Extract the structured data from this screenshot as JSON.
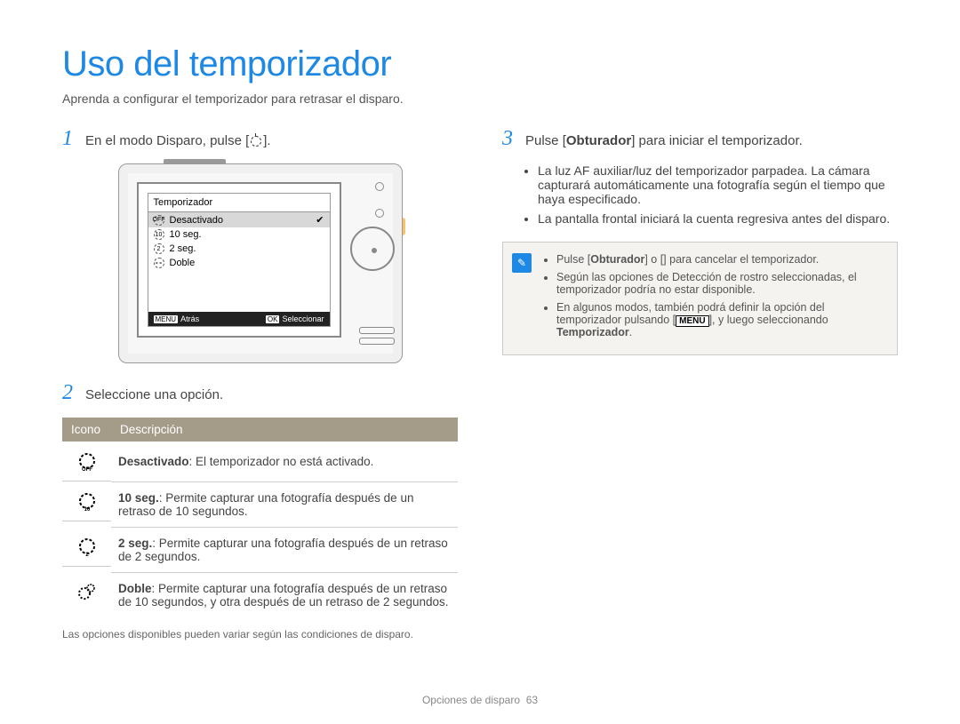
{
  "title": "Uso del temporizador",
  "subtitle": "Aprenda a configurar el temporizador para retrasar el disparo.",
  "steps": {
    "s1": {
      "num": "1",
      "text_before": "En el modo Disparo, pulse [",
      "text_after": "]."
    },
    "s2": {
      "num": "2",
      "text": "Seleccione una opción."
    },
    "s3": {
      "num": "3",
      "text_before": "Pulse [",
      "bold": "Obturador",
      "text_after": "] para iniciar el temporizador."
    }
  },
  "camera_menu": {
    "header": "Temporizador",
    "items": [
      "Desactivado",
      "10 seg.",
      "2 seg.",
      "Doble"
    ],
    "selected_index": 0,
    "footer_left_key": "MENU",
    "footer_left_label": "Atrás",
    "footer_right_key": "OK",
    "footer_right_label": "Seleccionar"
  },
  "s3_bullets": [
    "La luz AF auxiliar/luz del temporizador parpadea. La cámara capturará automáticamente una fotografía según el tiempo que haya especificado.",
    "La pantalla frontal iniciará la cuenta regresiva antes del disparo."
  ],
  "notes": {
    "n1_before": "Pulse [",
    "n1_bold1": "Obturador",
    "n1_mid": "] o [",
    "n1_after": "] para cancelar el temporizador.",
    "n2": "Según las opciones de Detección de rostro seleccionadas, el temporizador podría no estar disponible.",
    "n3_before": "En algunos modos, también podrá definir la opción del temporizador pulsando [",
    "n3_key": "MENU",
    "n3_mid": "], y luego seleccionando ",
    "n3_bold": "Temporizador",
    "n3_after": "."
  },
  "table": {
    "head_icon": "Icono",
    "head_desc": "Descripción",
    "rows": [
      {
        "bold": "Desactivado",
        "desc": ": El temporizador no está activado."
      },
      {
        "bold": "10 seg.",
        "desc": ": Permite capturar una fotografía después de un retraso de 10 segundos."
      },
      {
        "bold": "2 seg.",
        "desc": ": Permite capturar una fotografía después de un retraso de 2 segundos."
      },
      {
        "bold": "Doble",
        "desc": ": Permite capturar una fotografía después de un retraso de 10 segundos, y otra después de un retraso de 2 segundos."
      }
    ]
  },
  "footnote": "Las opciones disponibles pueden variar según las condiciones de disparo.",
  "page_footer_label": "Opciones de disparo",
  "page_number": "63"
}
